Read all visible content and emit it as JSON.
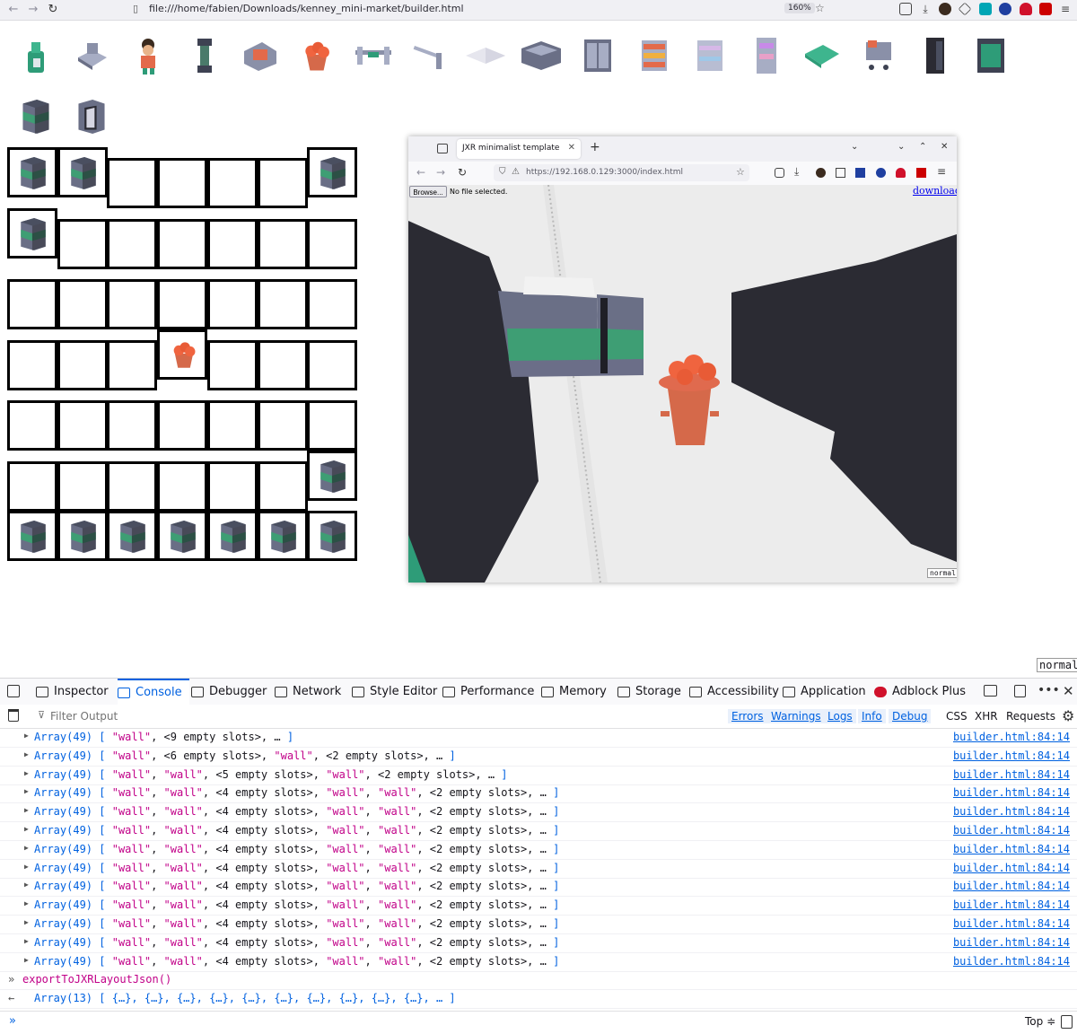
{
  "browser": {
    "url": "file:///home/fabien/Downloads/kenney_mini-market/builder.html",
    "zoom": "160%"
  },
  "palette": {
    "items": [
      {
        "name": "bottle-dispenser"
      },
      {
        "name": "cash-register"
      },
      {
        "name": "character"
      },
      {
        "name": "pillar"
      },
      {
        "name": "bread-box"
      },
      {
        "name": "fruit-basket"
      },
      {
        "name": "barrier"
      },
      {
        "name": "barrier-short"
      },
      {
        "name": "floor-tile"
      },
      {
        "name": "freezer-low"
      },
      {
        "name": "fridge-double"
      },
      {
        "name": "shelf-fruit"
      },
      {
        "name": "shelf-goods"
      },
      {
        "name": "shelf-drinks"
      },
      {
        "name": "cash-drawer"
      },
      {
        "name": "shopping-cart"
      },
      {
        "name": "fridge-tall"
      },
      {
        "name": "fridge-display"
      },
      {
        "name": "wall-cabinet"
      },
      {
        "name": "wall-door"
      }
    ]
  },
  "grid": {
    "rows": [
      [
        "wall",
        "wall",
        "",
        "",
        "",
        "",
        "wall"
      ],
      [
        "wall",
        "",
        "",
        "",
        "",
        "",
        ""
      ],
      [
        "",
        "",
        "",
        "",
        "",
        "",
        ""
      ],
      [
        "",
        "",
        "",
        "fruit-basket",
        "",
        "",
        ""
      ],
      [
        "",
        "",
        "",
        "",
        "",
        "",
        ""
      ],
      [
        "",
        "",
        "",
        "",
        "",
        "",
        "wall"
      ],
      [
        "wall",
        "wall",
        "wall",
        "wall",
        "wall",
        "wall",
        "wall"
      ]
    ]
  },
  "embedded_browser": {
    "tab_title": "JXR minimalist template",
    "url": "https://192.168.0.129:3000/index.html",
    "browse_label": "Browse...",
    "no_file_label": "No file selected.",
    "download_label": "download",
    "mode_label": "normal"
  },
  "page_mode_label": "normal",
  "devtools": {
    "tabs": [
      {
        "label": "Inspector"
      },
      {
        "label": "Console"
      },
      {
        "label": "Debugger"
      },
      {
        "label": "Network"
      },
      {
        "label": "Style Editor"
      },
      {
        "label": "Performance"
      },
      {
        "label": "Memory"
      },
      {
        "label": "Storage"
      },
      {
        "label": "Accessibility"
      },
      {
        "label": "Application"
      },
      {
        "label": "Adblock Plus"
      }
    ],
    "filter_placeholder": "Filter Output",
    "filters": [
      "Errors",
      "Warnings",
      "Logs",
      "Info",
      "Debug"
    ],
    "extra_filters": [
      "CSS",
      "XHR",
      "Requests"
    ],
    "top_select": "Top ≑",
    "console_rows": [
      {
        "text": "[ \"wall\", <9 empty slots>, … ]",
        "source": "builder.html:84:14"
      },
      {
        "text": "[ \"wall\", <6 empty slots>, \"wall\", <2 empty slots>, … ]",
        "source": "builder.html:84:14"
      },
      {
        "text": "[ \"wall\", \"wall\", <5 empty slots>, \"wall\", <2 empty slots>, … ]",
        "source": "builder.html:84:14"
      },
      {
        "text": "[ \"wall\", \"wall\", <4 empty slots>, \"wall\", \"wall\", <2 empty slots>, … ]",
        "source": "builder.html:84:14"
      },
      {
        "text": "[ \"wall\", \"wall\", <4 empty slots>, \"wall\", \"wall\", <2 empty slots>, … ]",
        "source": "builder.html:84:14"
      },
      {
        "text": "[ \"wall\", \"wall\", <4 empty slots>, \"wall\", \"wall\", <2 empty slots>, … ]",
        "source": "builder.html:84:14"
      },
      {
        "text": "[ \"wall\", \"wall\", <4 empty slots>, \"wall\", \"wall\", <2 empty slots>, … ]",
        "source": "builder.html:84:14"
      },
      {
        "text": "[ \"wall\", \"wall\", <4 empty slots>, \"wall\", \"wall\", <2 empty slots>, … ]",
        "source": "builder.html:84:14"
      },
      {
        "text": "[ \"wall\", \"wall\", <4 empty slots>, \"wall\", \"wall\", <2 empty slots>, … ]",
        "source": "builder.html:84:14"
      },
      {
        "text": "[ \"wall\", \"wall\", <4 empty slots>, \"wall\", \"wall\", <2 empty slots>, … ]",
        "source": "builder.html:84:14"
      },
      {
        "text": "[ \"wall\", \"wall\", <4 empty slots>, \"wall\", \"wall\", <2 empty slots>, … ]",
        "source": "builder.html:84:14"
      },
      {
        "text": "[ \"wall\", \"wall\", <4 empty slots>, \"wall\", \"wall\", <2 empty slots>, … ]",
        "source": "builder.html:84:14"
      },
      {
        "text": "[ \"wall\", \"wall\", <4 empty slots>, \"wall\", \"wall\", <2 empty slots>, … ]",
        "source": "builder.html:84:14"
      }
    ],
    "array_prefix": "Array(49)",
    "command": "exportToJXRLayoutJson()",
    "result_prefix": "Array(13)",
    "result_text": "[ {…}, {…}, {…}, {…}, {…}, {…}, {…}, {…}, {…}, {…}, … ]"
  }
}
